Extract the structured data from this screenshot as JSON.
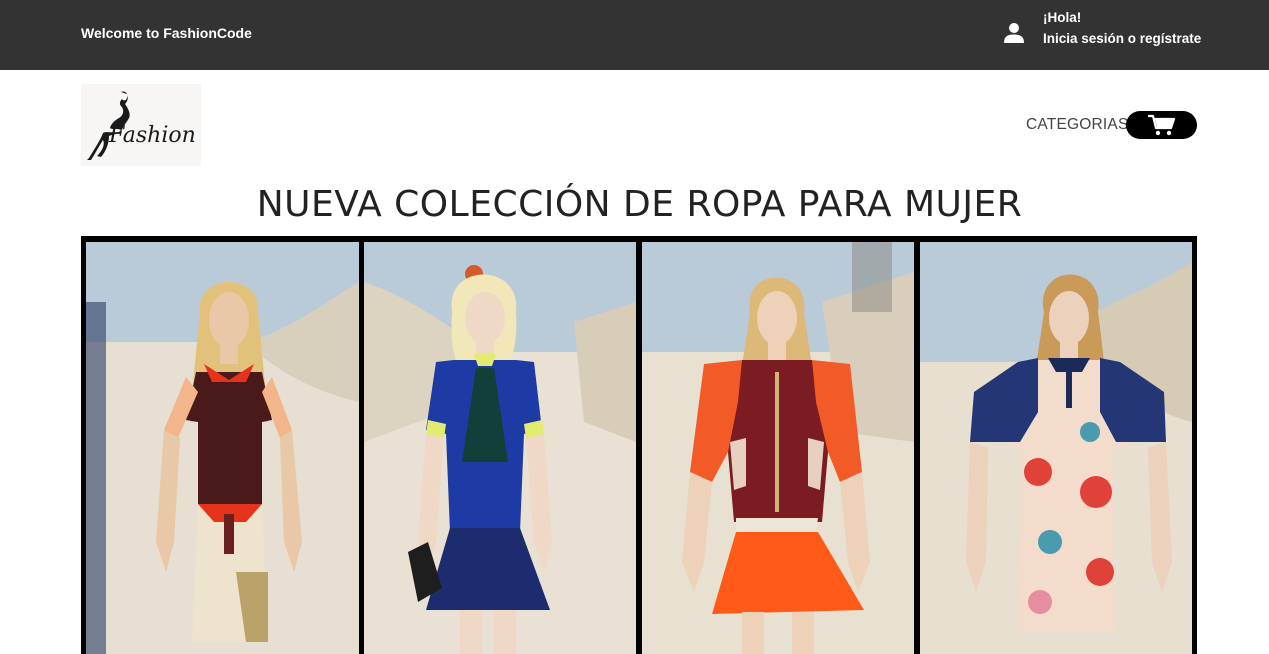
{
  "topbar": {
    "welcome": "Welcome to FashionCode",
    "greeting": "¡Hola!",
    "login_link": "Inicia sesión o regístrate"
  },
  "header": {
    "logo_text": "Fashion",
    "categories_label": "CATEGORIAS"
  },
  "hero": {
    "title": "NUEVA COLECCIÓN DE ROPA PARA MUJER"
  },
  "colors": {
    "topbar_bg": "#333333",
    "cart_bg": "#000000",
    "title_color": "#222222"
  },
  "icons": [
    "user-icon",
    "cart-icon"
  ]
}
